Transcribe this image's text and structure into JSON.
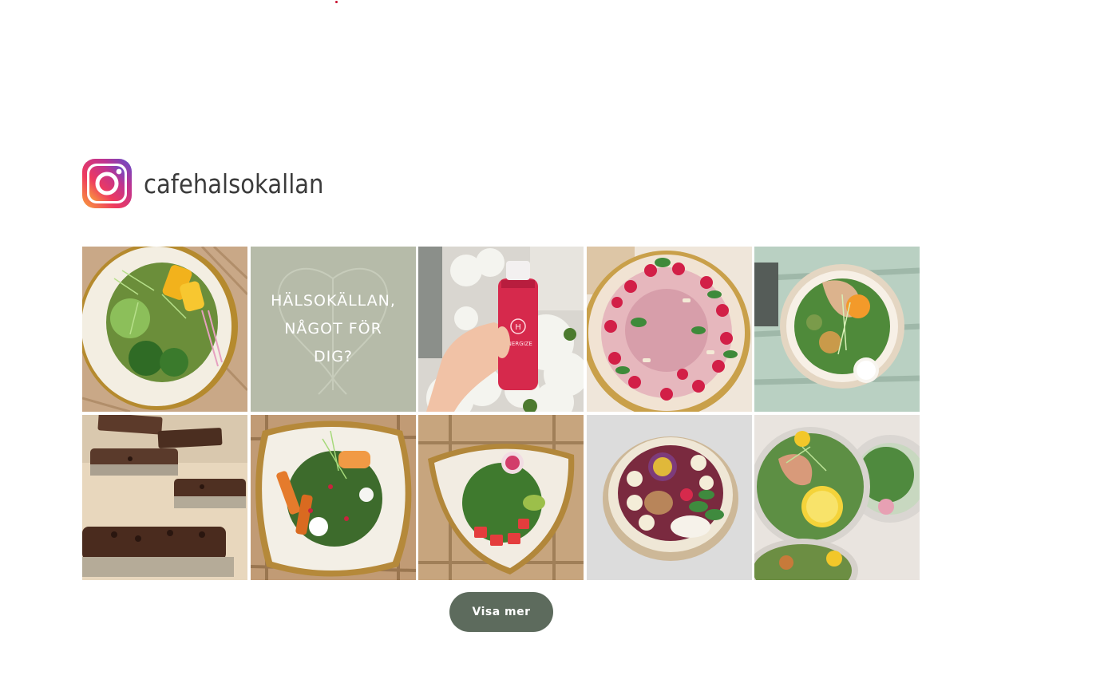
{
  "instagram": {
    "icon": "instagram-icon",
    "username": "cafehalsokallan"
  },
  "feed": {
    "posts": [
      {
        "name": "post-mango-salad-bowl",
        "alt": "mango-salad-image"
      },
      {
        "name": "post-halsokallan-quote",
        "alt": "quote-image",
        "text_lines": [
          "HÄLSOKÄLLAN,",
          "NÅGOT FÖR",
          "DIG?"
        ]
      },
      {
        "name": "post-energize-juice",
        "alt": "juice-bottle-image",
        "bottle_text": "ENERGIZE"
      },
      {
        "name": "post-raspberry-cake",
        "alt": "raspberry-cake-image"
      },
      {
        "name": "post-chicken-salad-bowl",
        "alt": "chicken-salad-image"
      },
      {
        "name": "post-chocolate-bars",
        "alt": "chocolate-bars-image"
      },
      {
        "name": "post-sweet-potato-salad",
        "alt": "sweet-potato-salad-image"
      },
      {
        "name": "post-watermelon-salad",
        "alt": "watermelon-salad-image"
      },
      {
        "name": "post-smoothie-bowl",
        "alt": "smoothie-bowl-image"
      },
      {
        "name": "post-takeaway-salads",
        "alt": "takeaway-salads-image"
      }
    ]
  },
  "actions": {
    "load_more_label": "Visa mer"
  },
  "colors": {
    "button_bg": "#5d6b5d",
    "quote_bg": "#b6bba9",
    "accent_red": "#c8102e"
  }
}
